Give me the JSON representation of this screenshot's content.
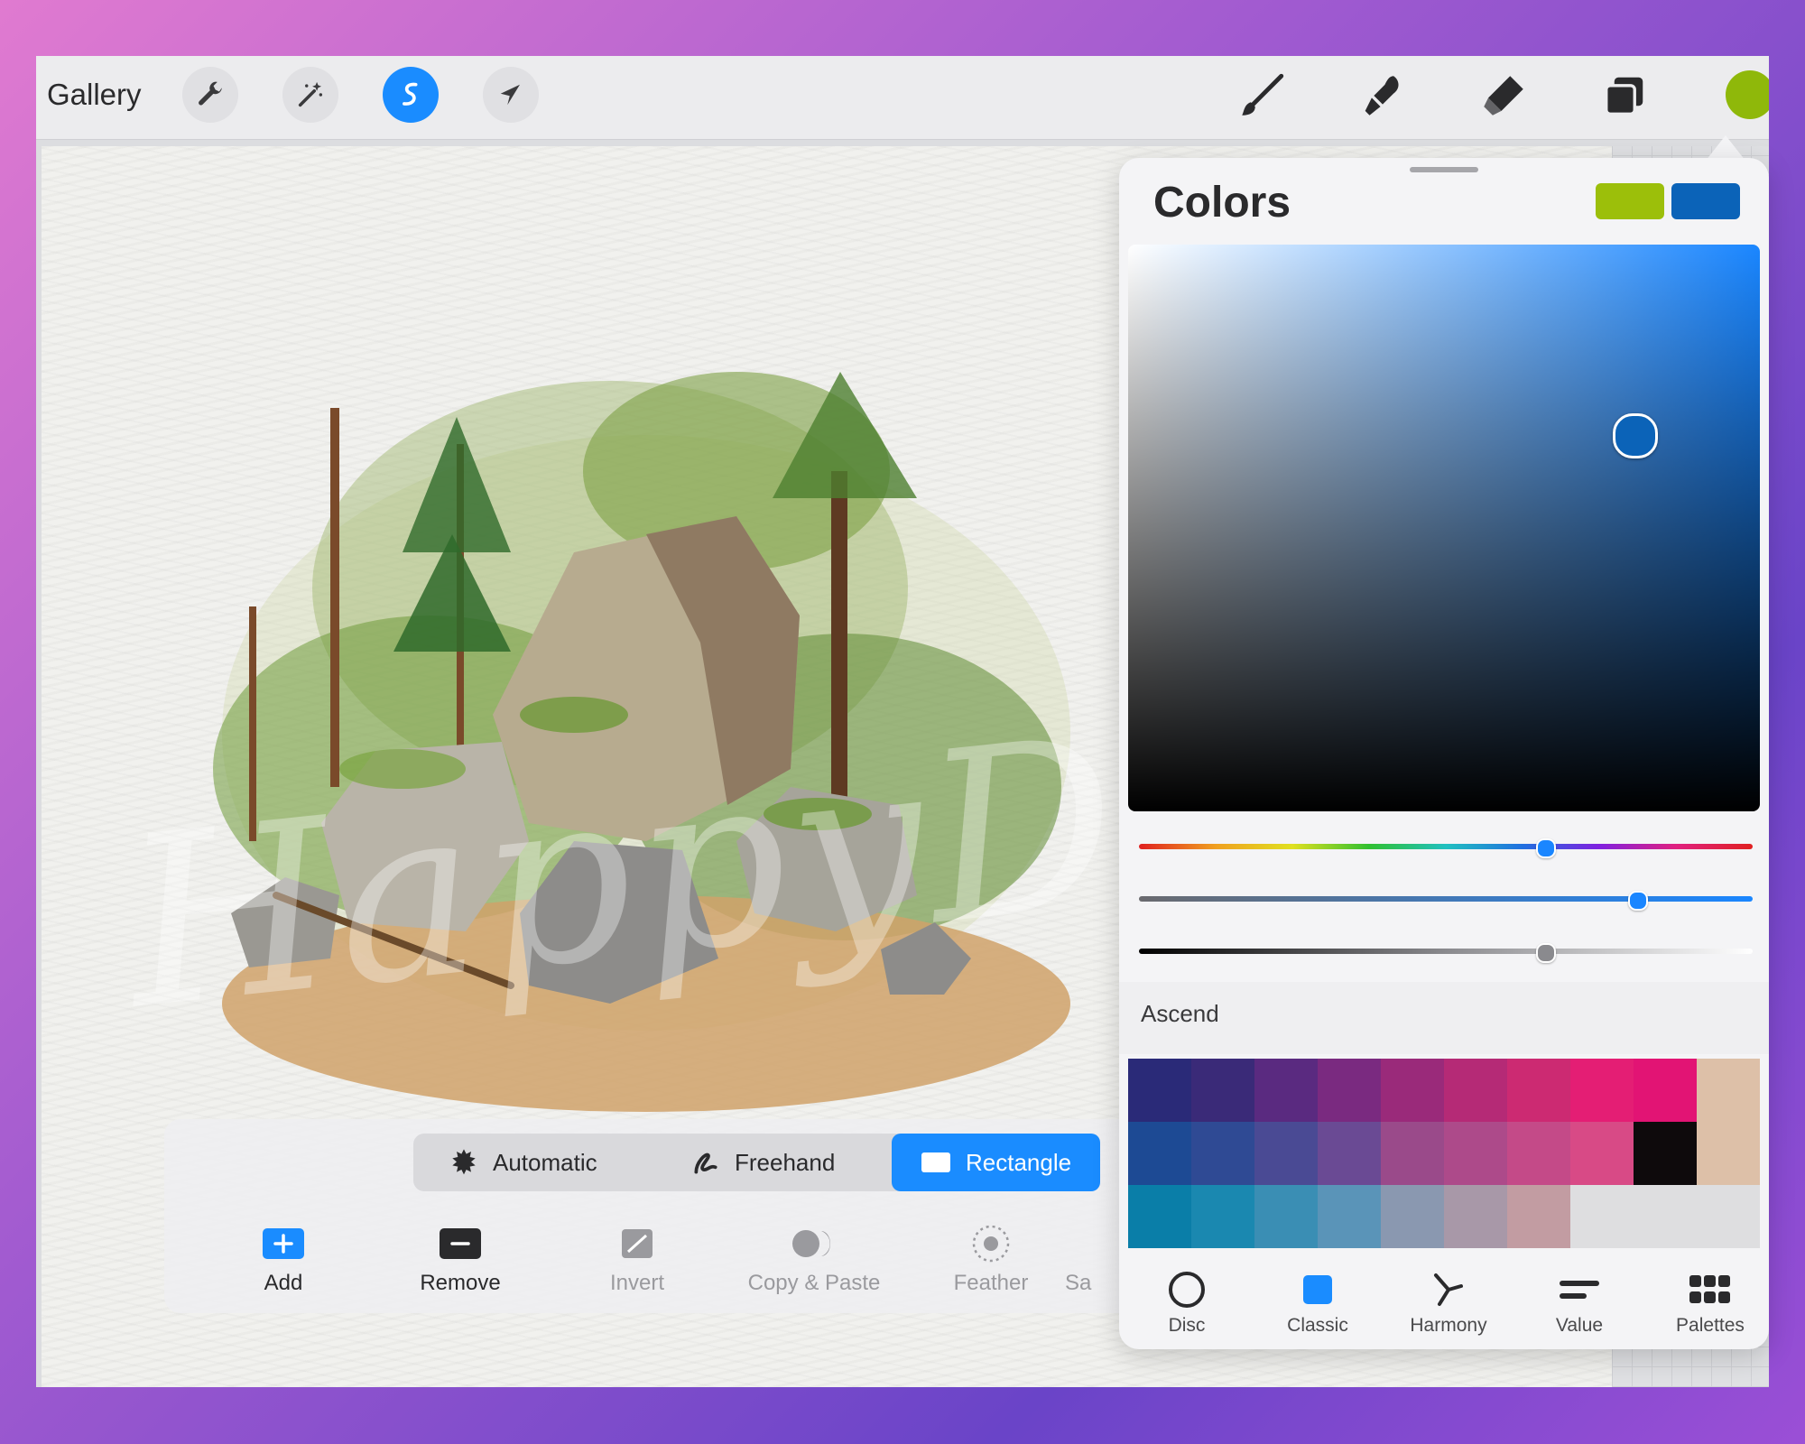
{
  "topbar": {
    "gallery_label": "Gallery",
    "tools": [
      "wrench-icon",
      "magic-wand-icon",
      "selection-icon",
      "transform-arrow-icon"
    ],
    "right_tools": [
      "brush-icon",
      "smudge-icon",
      "eraser-icon",
      "layers-icon"
    ],
    "active_color": "#8fb80a"
  },
  "canvas": {
    "watermark": "HappyDesignID"
  },
  "selection": {
    "modes": [
      {
        "label": "Automatic"
      },
      {
        "label": "Freehand"
      },
      {
        "label": "Rectangle"
      }
    ],
    "actions": [
      {
        "label": "Add"
      },
      {
        "label": "Remove"
      },
      {
        "label": "Invert"
      },
      {
        "label": "Copy & Paste"
      },
      {
        "label": "Feather"
      },
      {
        "label": "Sa"
      }
    ]
  },
  "colors": {
    "title": "Colors",
    "primary_swatch": "#9cbf0a",
    "secondary_swatch": "#0b63b8",
    "palette_name": "Ascend",
    "palette": [
      "#2a2a78",
      "#3a2a78",
      "#5a2a80",
      "#7a2a80",
      "#9a2a7a",
      "#b52a76",
      "#cc2a72",
      "#e41e74",
      "#e21474",
      "#ddc0a8",
      "#1d4a94",
      "#2f4a94",
      "#4a4a94",
      "#6a4a94",
      "#9a4a8a",
      "#ad4a8a",
      "#c44a88",
      "#d84a86",
      "#0e0a0c",
      "#ddc0a8",
      "#0a7ea8",
      "#1a88b0",
      "#3a8eb4",
      "#5a94b8",
      "#8a98b0",
      "#a898a8",
      "#c29ca2",
      "#dedee0",
      "#dedee0",
      "#dedee0"
    ],
    "tabs": [
      {
        "label": "Disc",
        "icon": "disc-icon"
      },
      {
        "label": "Classic",
        "icon": "classic-icon"
      },
      {
        "label": "Harmony",
        "icon": "harmony-icon"
      },
      {
        "label": "Value",
        "icon": "value-icon"
      },
      {
        "label": "Palettes",
        "icon": "palettes-icon"
      }
    ]
  }
}
